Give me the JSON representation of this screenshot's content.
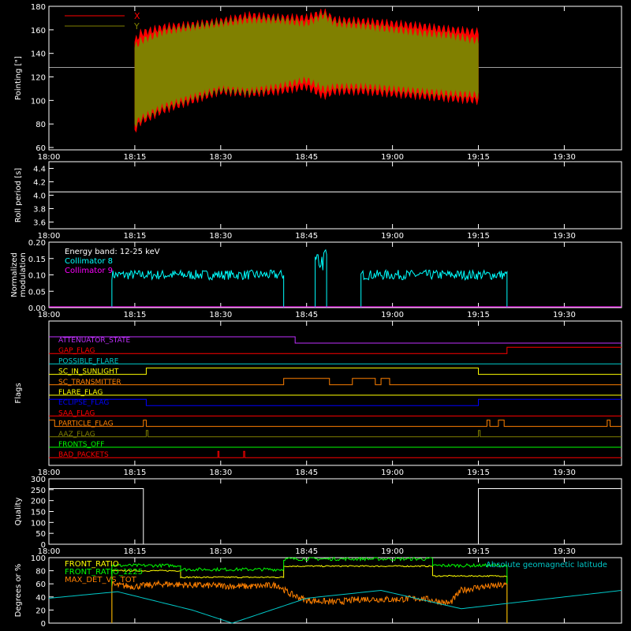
{
  "time_axis": {
    "ticks": [
      {
        "min": 0,
        "label": "18:00"
      },
      {
        "min": 15,
        "label": "18:15"
      },
      {
        "min": 30,
        "label": "18:30"
      },
      {
        "min": 45,
        "label": "18:45"
      },
      {
        "min": 60,
        "label": "19:00"
      },
      {
        "min": 75,
        "label": "19:15"
      },
      {
        "min": 90,
        "label": "19:30"
      }
    ],
    "range_minutes": [
      0,
      100
    ]
  },
  "chart_data": [
    {
      "id": "pointing",
      "type": "line",
      "ylabel": "Pointing [\"]",
      "ylim": [
        58,
        180
      ],
      "yticks": [
        60,
        80,
        100,
        120,
        140,
        160,
        180
      ],
      "legend": [
        {
          "name": "X",
          "color": "#ff0000"
        },
        {
          "name": "Y",
          "color": "#808000"
        }
      ],
      "reference_line": 128,
      "data_range_minutes": [
        15,
        75
      ],
      "series": [
        {
          "name": "X",
          "color": "#ff0000",
          "envelope_x": [
            15,
            16,
            20,
            25,
            30,
            35,
            40,
            45,
            48,
            50,
            55,
            60,
            65,
            70,
            75
          ],
          "envelope_low": [
            75,
            82,
            92,
            100,
            108,
            106,
            108,
            112,
            104,
            108,
            108,
            106,
            104,
            102,
            100
          ],
          "envelope_high": [
            150,
            157,
            162,
            164,
            167,
            172,
            170,
            170,
            175,
            168,
            167,
            165,
            163,
            160,
            158
          ]
        },
        {
          "name": "Y",
          "color": "#808000",
          "envelope_x": [
            15,
            16,
            20,
            25,
            30,
            35,
            40,
            45,
            48,
            50,
            55,
            60,
            65,
            70,
            75
          ],
          "envelope_low": [
            80,
            85,
            95,
            103,
            110,
            108,
            112,
            118,
            110,
            112,
            112,
            110,
            108,
            106,
            105
          ],
          "envelope_high": [
            145,
            150,
            158,
            162,
            165,
            168,
            168,
            165,
            172,
            165,
            163,
            160,
            157,
            155,
            150
          ]
        }
      ]
    },
    {
      "id": "roll-period",
      "type": "line",
      "ylabel": "Roll period [s]",
      "ylim": [
        3.5,
        4.5
      ],
      "yticks": [
        3.6,
        3.8,
        4.0,
        4.2,
        4.4
      ],
      "series": [
        {
          "name": "",
          "color": "#ffffff",
          "x": [
            0,
            100
          ],
          "y": [
            4.05,
            4.05
          ]
        }
      ]
    },
    {
      "id": "modulation",
      "type": "line",
      "ylabel": "Normalized modulation",
      "ylim": [
        0,
        0.2
      ],
      "yticks": [
        0.0,
        0.05,
        0.1,
        0.15,
        0.2
      ],
      "annotation": "Energy band: 12-25 keV",
      "legend": [
        {
          "name": "Collimator 8",
          "color": "#00ffff"
        },
        {
          "name": "Collimator 9",
          "color": "#ff00ff"
        }
      ],
      "series": [
        {
          "name": "Collimator 8",
          "color": "#00ffff",
          "segments": [
            {
              "x0": 11,
              "x1": 41,
              "level": 0.1
            },
            {
              "x0": 46.5,
              "x1": 48.5,
              "level": 0.13
            },
            {
              "x0": 54.5,
              "x1": 80,
              "level": 0.1
            }
          ]
        },
        {
          "name": "Collimator 9",
          "color": "#ff00ff",
          "x": [
            0,
            100
          ],
          "y": [
            0,
            0
          ]
        }
      ]
    },
    {
      "id": "flags",
      "type": "line",
      "ylabel": "Flags",
      "flags": [
        {
          "name": "ATTENUATOR_STATE",
          "color": "#c030ff",
          "transitions": [
            [
              0,
              1
            ],
            [
              43,
              0
            ],
            [
              100,
              0
            ]
          ]
        },
        {
          "name": "GAP_FLAG",
          "color": "#ff0000",
          "transitions": [
            [
              0,
              0
            ],
            [
              80,
              1
            ],
            [
              100,
              1
            ]
          ]
        },
        {
          "name": "POSSIBLE_FLARE",
          "color": "#00c8c8",
          "transitions": [
            [
              0,
              0
            ],
            [
              100,
              0
            ]
          ]
        },
        {
          "name": "SC_IN_SUNLIGHT",
          "color": "#ffff00",
          "transitions": [
            [
              0,
              0
            ],
            [
              17,
              1
            ],
            [
              75,
              0
            ],
            [
              100,
              0
            ]
          ]
        },
        {
          "name": "SC_TRANSMITTER",
          "color": "#ff8000",
          "transitions": [
            [
              0,
              0
            ],
            [
              41,
              1
            ],
            [
              49,
              0
            ],
            [
              53,
              1
            ],
            [
              57,
              0
            ],
            [
              58,
              1
            ],
            [
              59.5,
              0
            ],
            [
              100,
              0
            ]
          ]
        },
        {
          "name": "FLARE_FLAG",
          "color": "#ffff00",
          "transitions": [
            [
              0,
              0
            ],
            [
              100,
              0
            ]
          ]
        },
        {
          "name": "ECLIPSE_FLAG",
          "color": "#0000ff",
          "transitions": [
            [
              0,
              1
            ],
            [
              17,
              0
            ],
            [
              75,
              1
            ],
            [
              100,
              1
            ]
          ]
        },
        {
          "name": "SAA_FLAG",
          "color": "#ff0000",
          "transitions": [
            [
              0,
              0
            ],
            [
              100,
              0
            ]
          ]
        },
        {
          "name": "PARTICLE_FLAG",
          "color": "#ff8000",
          "transitions": [
            [
              0,
              1
            ],
            [
              1,
              0
            ],
            [
              16.5,
              1
            ],
            [
              17,
              0
            ],
            [
              76.5,
              1
            ],
            [
              77,
              0
            ],
            [
              78.5,
              1
            ],
            [
              79.5,
              0
            ],
            [
              97.5,
              1
            ],
            [
              98,
              0
            ],
            [
              100,
              0
            ]
          ]
        },
        {
          "name": "AAZ_FLAG",
          "color": "#808000",
          "transitions": [
            [
              0,
              0
            ],
            [
              17,
              1
            ],
            [
              17.3,
              0
            ],
            [
              75,
              1
            ],
            [
              75.3,
              0
            ],
            [
              100,
              0
            ]
          ]
        },
        {
          "name": "FRONTS_OFF",
          "color": "#00ff00",
          "transitions": [
            [
              0,
              0
            ],
            [
              100,
              0
            ]
          ]
        },
        {
          "name": "BAD_PACKETS",
          "color": "#ff0000",
          "transitions": [
            [
              0,
              0
            ],
            [
              29.5,
              1
            ],
            [
              29.7,
              0
            ],
            [
              34,
              1
            ],
            [
              34.2,
              0
            ],
            [
              100,
              0
            ]
          ]
        }
      ]
    },
    {
      "id": "quality",
      "type": "line",
      "ylabel": "Quality",
      "ylim": [
        0,
        300
      ],
      "yticks": [
        0,
        50,
        100,
        150,
        200,
        250,
        300
      ],
      "series": [
        {
          "name": "",
          "color": "#ffffff",
          "x": [
            0,
            16.5,
            16.5,
            75,
            75,
            100
          ],
          "y": [
            255,
            255,
            0,
            0,
            255,
            255
          ]
        }
      ]
    },
    {
      "id": "ratios",
      "type": "line",
      "ylabel": "Degrees or %",
      "ylim": [
        0,
        100
      ],
      "yticks": [
        0,
        20,
        40,
        60,
        80,
        100
      ],
      "legend": [
        {
          "name": "FRONT_RATIO",
          "color": "#ffff00"
        },
        {
          "name": "FRONT_RATIO_1225",
          "color": "#00ff00"
        },
        {
          "name": "MAX_DET_VS_TOT",
          "color": "#ff8000"
        },
        {
          "name": "Absolute geomagnetic latitude",
          "color": "#00c8c8"
        }
      ],
      "series": [
        {
          "name": "FRONT_RATIO",
          "color": "#ffff00",
          "steps": [
            [
              11,
              80
            ],
            [
              23,
              70
            ],
            [
              41,
              87
            ],
            [
              67,
              72
            ],
            [
              80,
              72
            ]
          ]
        },
        {
          "name": "FRONT_RATIO_1225",
          "color": "#00ff00",
          "steps": [
            [
              11,
              88
            ],
            [
              23,
              82
            ],
            [
              41,
              98
            ],
            [
              67,
              88
            ],
            [
              80,
              88
            ]
          ]
        },
        {
          "name": "MAX_DET_VS_TOT",
          "color": "#ff8000",
          "x": [
            11,
            15,
            20,
            25,
            30,
            35,
            40,
            42,
            45,
            50,
            55,
            60,
            65,
            70,
            72,
            75,
            80
          ],
          "y": [
            58,
            56,
            60,
            58,
            57,
            56,
            58,
            45,
            35,
            32,
            37,
            36,
            38,
            30,
            50,
            55,
            58
          ]
        },
        {
          "name": "Absolute geomagnetic latitude",
          "color": "#00c8c8",
          "x": [
            0,
            12,
            25,
            32,
            45,
            58,
            72,
            100
          ],
          "y": [
            38,
            48,
            20,
            0,
            38,
            50,
            22,
            50
          ]
        }
      ]
    }
  ]
}
